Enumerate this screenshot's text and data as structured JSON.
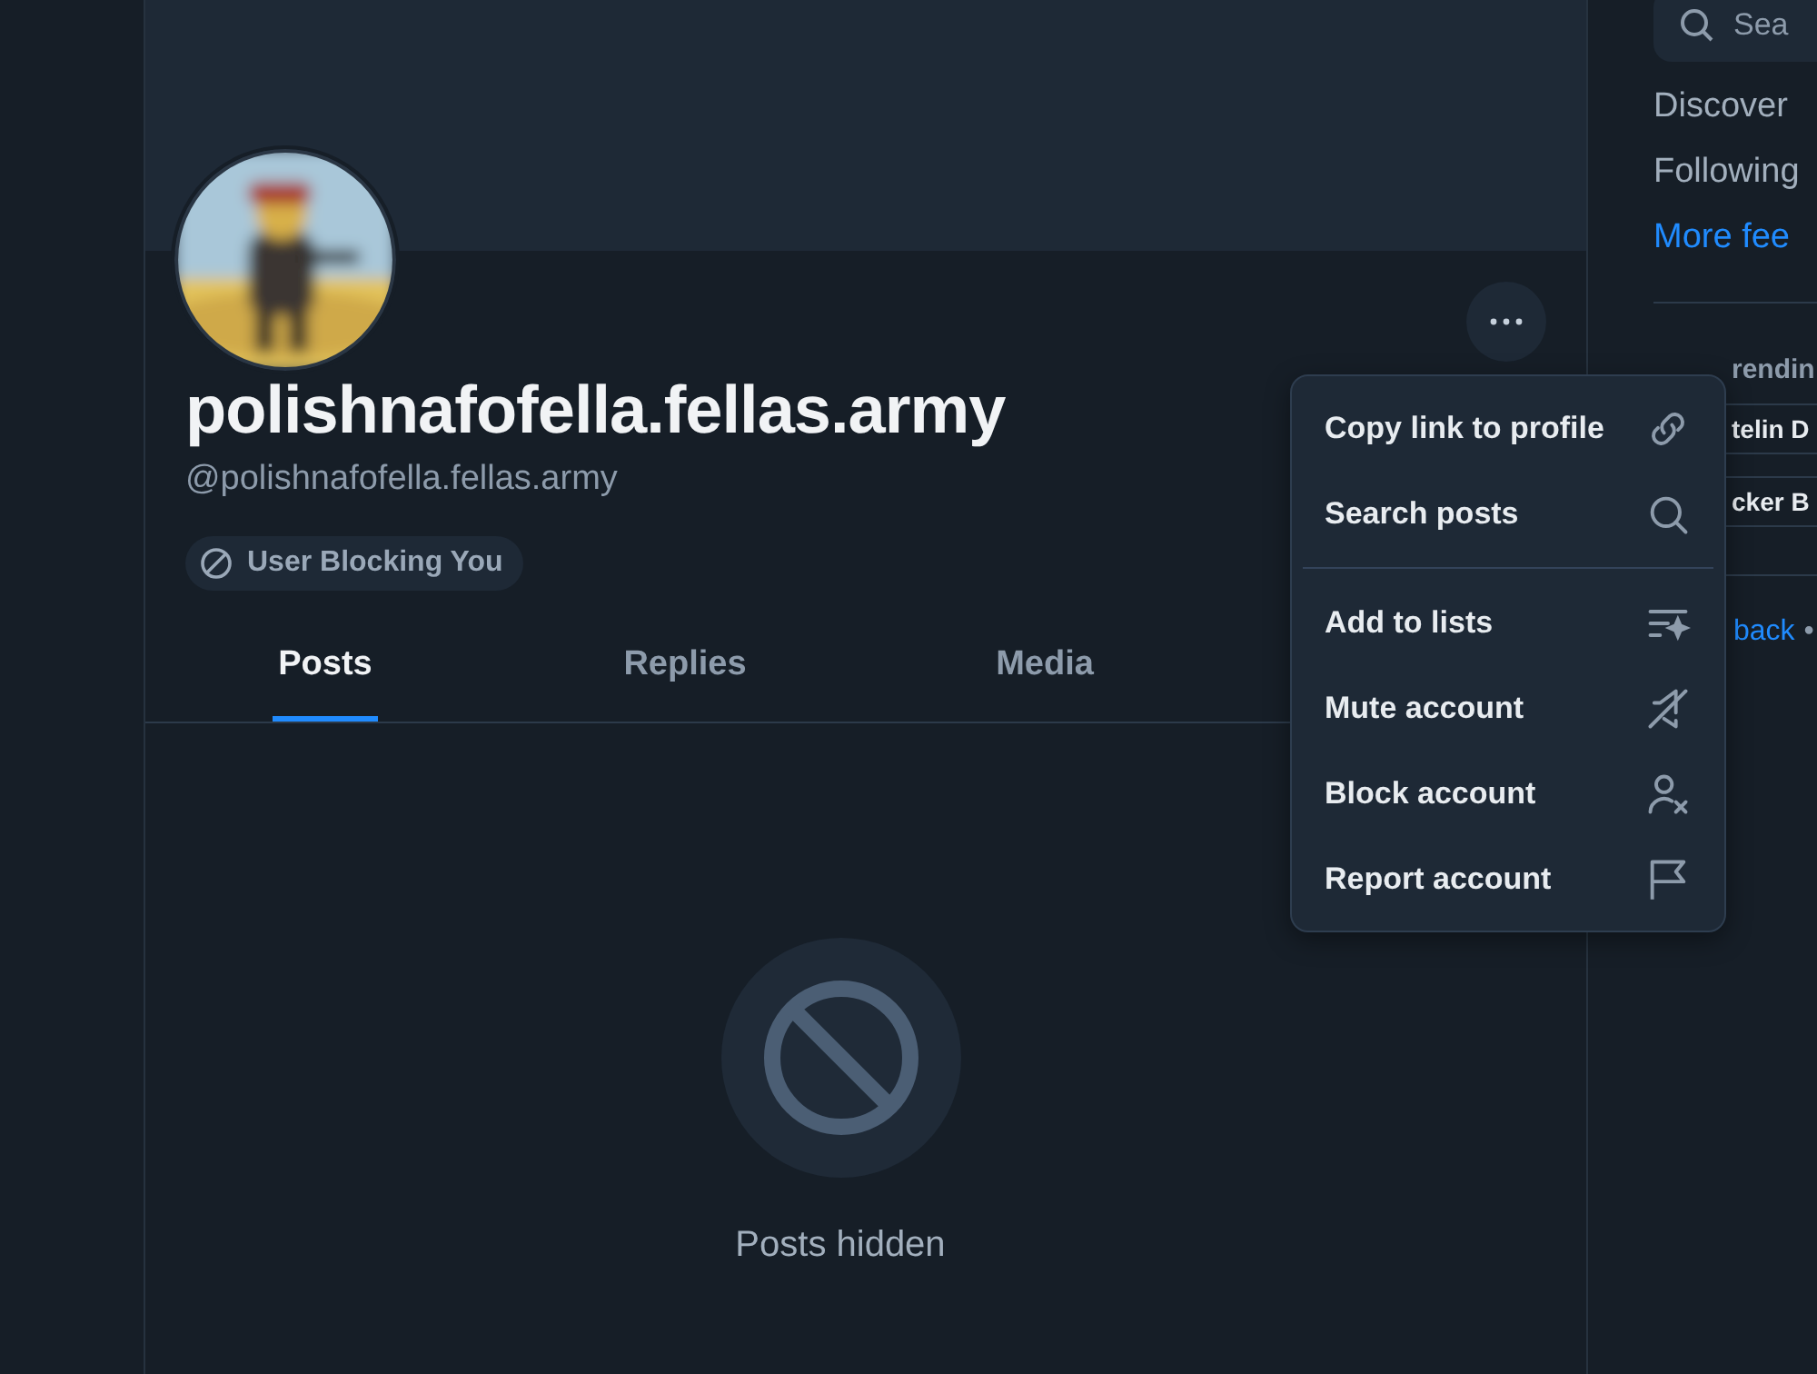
{
  "profile": {
    "display_name": "polishnafofella.fellas.army",
    "handle": "@polishnafofella.fellas.army",
    "badge": "User Blocking You"
  },
  "tabs": [
    {
      "label": "Posts",
      "selected": true
    },
    {
      "label": "Replies",
      "selected": false
    },
    {
      "label": "Media",
      "selected": false
    }
  ],
  "empty_state": {
    "text": "Posts hidden"
  },
  "menu": {
    "sections": [
      [
        {
          "label": "Copy link to profile",
          "kind": "link"
        },
        {
          "label": "Search posts",
          "kind": "search"
        }
      ],
      [
        {
          "label": "Add to lists",
          "kind": "list"
        },
        {
          "label": "Mute account",
          "kind": "mute"
        },
        {
          "label": "Block account",
          "kind": "block"
        },
        {
          "label": "Report account",
          "kind": "report"
        }
      ]
    ]
  },
  "sidebar": {
    "search": {
      "placeholder": "Sea"
    },
    "feeds": [
      {
        "label": "Discover",
        "kind": "plain"
      },
      {
        "label": "Following",
        "kind": "plain"
      },
      {
        "label": "More fee",
        "kind": "link"
      }
    ],
    "trending": {
      "title": "rendin",
      "items": [
        "telin D",
        "cker B"
      ]
    },
    "footer": [
      {
        "label": "back",
        "kind": "link"
      },
      {
        "label": "•",
        "kind": "separator"
      }
    ]
  }
}
